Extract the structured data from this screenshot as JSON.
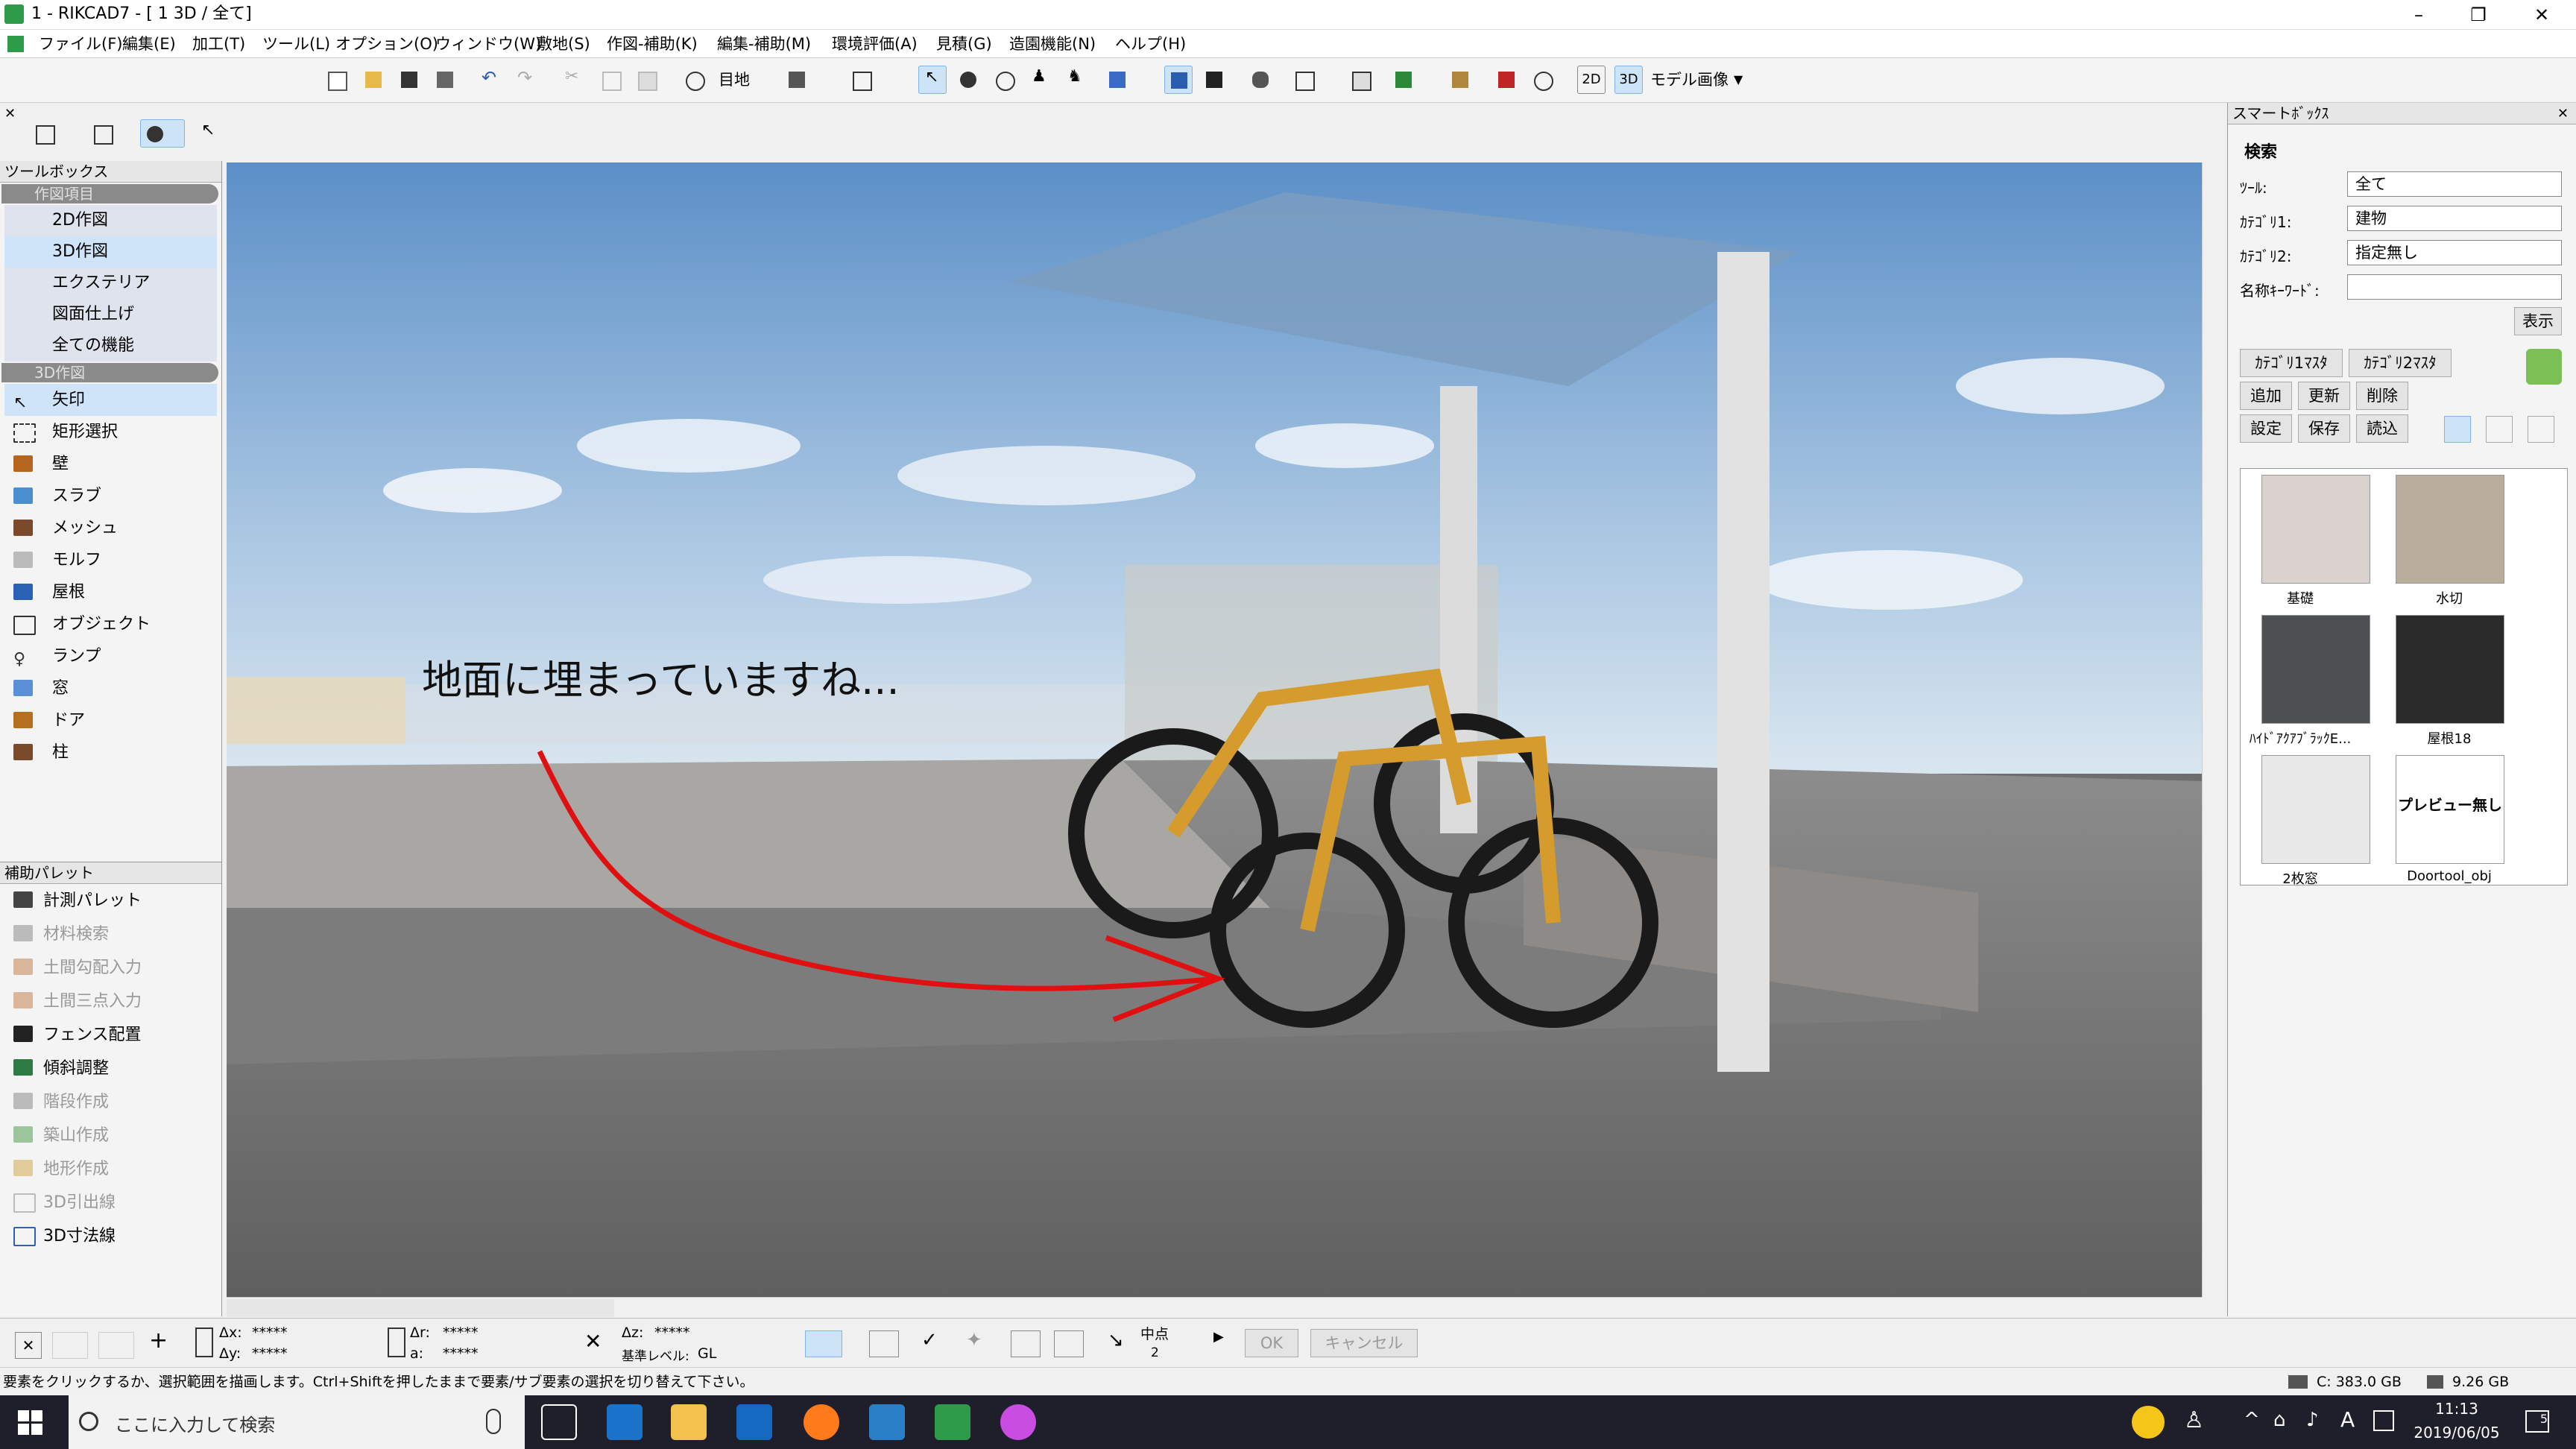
{
  "window": {
    "title": "1 - RIKCAD7 - [ 1 3D / 全て]",
    "minimize": "–",
    "restore": "❐",
    "close": "✕"
  },
  "menu": [
    "ファイル(F)",
    "編集(E)",
    "加工(T)",
    "ツール(L)",
    "オプション(O)",
    "ウィンドウ(W)",
    "敷地(S)",
    "作図-補助(K)",
    "編集-補助(M)",
    "環境評価(A)",
    "見積(G)",
    "造園機能(N)",
    "ヘルプ(H)"
  ],
  "toolbar": {
    "view_label": "目地",
    "model_label": "モデル画像",
    "mode_2d": "2D",
    "mode_3d": "3D"
  },
  "toolbox": {
    "title": "ツールボックス",
    "group1": "作図項目",
    "nav": [
      "2D作図",
      "3D作図",
      "エクステリア",
      "図面仕上げ",
      "全ての機能"
    ],
    "group2": "3D作図",
    "tools": [
      "矢印",
      "矩形選択",
      "壁",
      "スラブ",
      "メッシュ",
      "モルフ",
      "屋根",
      "オブジェクト",
      "ランプ",
      "窓",
      "ドア",
      "柱"
    ]
  },
  "palette": {
    "title": "補助パレット",
    "items": [
      {
        "label": "計測パレット",
        "enabled": true
      },
      {
        "label": "材料検索",
        "enabled": false
      },
      {
        "label": "土間勾配入力",
        "enabled": false
      },
      {
        "label": "土間三点入力",
        "enabled": false
      },
      {
        "label": "フェンス配置",
        "enabled": true
      },
      {
        "label": "傾斜調整",
        "enabled": true
      },
      {
        "label": "階段作成",
        "enabled": false
      },
      {
        "label": "築山作成",
        "enabled": false
      },
      {
        "label": "地形作成",
        "enabled": false
      },
      {
        "label": "3D引出線",
        "enabled": false
      },
      {
        "label": "3D寸法線",
        "enabled": true
      }
    ]
  },
  "viewport": {
    "annotation": "地面に埋まっていますね..."
  },
  "smart": {
    "title": "スマートﾎﾞｯｸｽ",
    "search_header": "検索",
    "tool_label": "ﾂｰﾙ:",
    "tool_value": "全て",
    "cat1_label": "ｶﾃｺﾞﾘ1:",
    "cat1_value": "建物",
    "cat2_label": "ｶﾃｺﾞﾘ2:",
    "cat2_value": "指定無し",
    "keyword_label": "名称ｷｰﾜｰﾄﾞ:",
    "keyword_value": "",
    "show_button": "表示",
    "cat1_master": "ｶﾃｺﾞﾘ1ﾏｽﾀ",
    "cat2_master": "ｶﾃｺﾞﾘ2ﾏｽﾀ",
    "add": "追加",
    "update": "更新",
    "delete": "削除",
    "settings": "設定",
    "save": "保存",
    "load": "読込",
    "items": [
      {
        "name": "基礎",
        "color": "#d9d2cf"
      },
      {
        "name": "水切",
        "color": "#b8ad9a"
      },
      {
        "name": "ﾊｲﾄﾞｱｸｱﾌﾞﾗｯｸE...",
        "color": "#4d4f52"
      },
      {
        "name": "屋根18",
        "color": "#2a2a2a"
      },
      {
        "name": "2枚窓",
        "color": "#e8e8e8"
      },
      {
        "name": "Doortool_obj",
        "color": "#ffffff",
        "text": "プレビュー無し"
      }
    ]
  },
  "infobar": {
    "dx_label": "Δx:",
    "dx_value": "*****",
    "dy_label": "Δy:",
    "dy_value": "*****",
    "dr_label": "Δr:",
    "dr_value": "*****",
    "a_label": "a:",
    "a_value": "*****",
    "dz_label": "Δz:",
    "dz_value": "*****",
    "level_label": "基準レベル:",
    "level_value": "GL",
    "midpoint_label": "中点",
    "midpoint_num": "2",
    "ok": "OK",
    "cancel": "キャンセル"
  },
  "status": {
    "message": "要素をクリックするか、選択範囲を描画します。Ctrl+Shiftを押したままで要素/サブ要素の選択を切り替えて下さい。",
    "disk_c": "C: 383.0 GB",
    "disk_other": "9.26 GB"
  },
  "taskbar": {
    "search_placeholder": "ここに入力して検索",
    "time": "11:13",
    "date": "2019/06/05",
    "ime": "A",
    "notify": "5"
  }
}
